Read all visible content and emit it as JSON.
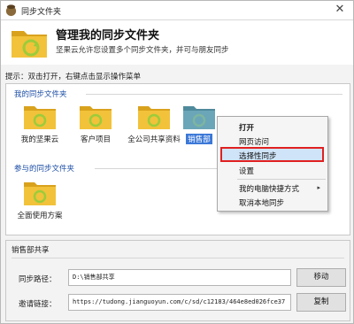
{
  "window": {
    "title": "同步文件夹",
    "close": "✕"
  },
  "header": {
    "title": "管理我的同步文件夹",
    "subtitle": "坚果云允许您设置多个同步文件夹，并可与朋友同步"
  },
  "hint": "提示：双击打开，右键点击显示操作菜单",
  "my_folders": {
    "label": "我的同步文件夹",
    "items": [
      {
        "label": "我的坚果云"
      },
      {
        "label": "客户项目"
      },
      {
        "label": "全公司共享资料"
      },
      {
        "label": "销售部"
      }
    ]
  },
  "joined_folders": {
    "label": "参与的同步文件夹",
    "items": [
      {
        "label": "全面使用方案"
      }
    ]
  },
  "context_menu": {
    "items": [
      "打开",
      "网页访问",
      "选择性同步",
      "设置",
      "我的电脑快捷方式",
      "取消本地同步"
    ],
    "submenu_arrow": "▸"
  },
  "detail": {
    "name": "销售部共享",
    "path_label": "同步路径：",
    "path_value": "D:\\销售部共享",
    "move_button": "移动",
    "link_label": "邀请链接：",
    "link_value": "https://tudong.jianguoyun.com/c/sd/c12183/464e8ed026fce37",
    "copy_button": "复制"
  },
  "colors": {
    "folder_yellow": "#f2c23a",
    "folder_dark": "#d9a21d",
    "sync_green": "#9ccc3a",
    "selection": "#3b78d8",
    "highlight_border": "#e02020"
  }
}
